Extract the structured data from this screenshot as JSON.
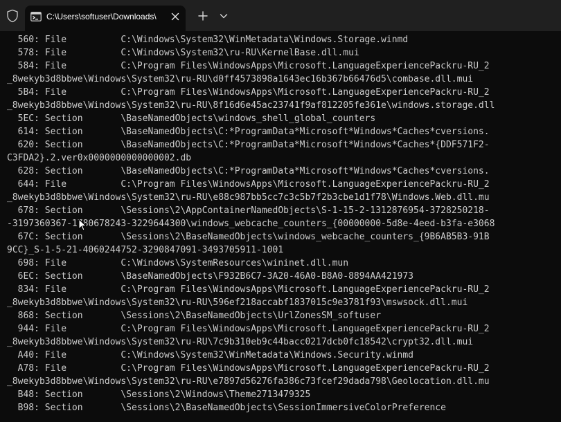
{
  "window": {
    "tab_title": "C:\\Users\\softuser\\Downloads\\",
    "icons": {
      "shield": "shield-icon",
      "tab": "terminal-icon",
      "close": "close-icon",
      "new_tab": "plus-icon",
      "dropdown": "chevron-down-icon"
    },
    "colors": {
      "tabbar": "#202020",
      "background": "#0c0c0c",
      "text": "#cccccc"
    }
  },
  "console": {
    "lines": [
      "  560: File          C:\\Windows\\System32\\WinMetadata\\Windows.Storage.winmd",
      "  578: File          C:\\Windows\\System32\\ru-RU\\KernelBase.dll.mui",
      "  584: File          C:\\Program Files\\WindowsApps\\Microsoft.LanguageExperiencePackru-RU_2",
      "_8wekyb3d8bbwe\\Windows\\System32\\ru-RU\\d0ff4573898a1643ec16b367b66476d5\\combase.dll.mui",
      "  5B4: File          C:\\Program Files\\WindowsApps\\Microsoft.LanguageExperiencePackru-RU_2",
      "_8wekyb3d8bbwe\\Windows\\System32\\ru-RU\\8f16d6e45ac23741f9af812205fe361e\\windows.storage.dll",
      "  5EC: Section       \\BaseNamedObjects\\windows_shell_global_counters",
      "  614: Section       \\BaseNamedObjects\\C:*ProgramData*Microsoft*Windows*Caches*cversions.",
      "  620: Section       \\BaseNamedObjects\\C:*ProgramData*Microsoft*Windows*Caches*{DDF571F2-",
      "C3FDA2}.2.ver0x0000000000000002.db",
      "  628: Section       \\BaseNamedObjects\\C:*ProgramData*Microsoft*Windows*Caches*cversions.",
      "  644: File          C:\\Program Files\\WindowsApps\\Microsoft.LanguageExperiencePackru-RU_2",
      "_8wekyb3d8bbwe\\Windows\\System32\\ru-RU\\e88c987bb5cc7c3c5b7f2b3cbe1d1f78\\Windows.Web.dll.mu",
      "  678: Section       \\Sessions\\2\\AppContainerNamedObjects\\S-1-15-2-1312876954-3728250218-",
      "-3197360367-1780678243-3229644300\\windows_webcache_counters_{00000000-5d8e-4eed-b3fa-e3068",
      "  67C: Section       \\Sessions\\2\\BaseNamedObjects\\windows_webcache_counters_{9B6AB5B3-91B",
      "9CC}_S-1-5-21-4060244752-3290847091-3493705911-1001",
      "  698: File          C:\\Windows\\SystemResources\\wininet.dll.mun",
      "  6EC: Section       \\BaseNamedObjects\\F932B6C7-3A20-46A0-B8A0-8894AA421973",
      "  834: File          C:\\Program Files\\WindowsApps\\Microsoft.LanguageExperiencePackru-RU_2",
      "_8wekyb3d8bbwe\\Windows\\System32\\ru-RU\\596ef218accabf1837015c9e3781f93\\mswsock.dll.mui",
      "  868: Section       \\Sessions\\2\\BaseNamedObjects\\UrlZonesSM_softuser",
      "  944: File          C:\\Program Files\\WindowsApps\\Microsoft.LanguageExperiencePackru-RU_2",
      "_8wekyb3d8bbwe\\Windows\\System32\\ru-RU\\7c9b310eb9c44bacc0217dcb0fc18542\\crypt32.dll.mui",
      "  A40: File          C:\\Windows\\System32\\WinMetadata\\Windows.Security.winmd",
      "  A78: File          C:\\Program Files\\WindowsApps\\Microsoft.LanguageExperiencePackru-RU_2",
      "_8wekyb3d8bbwe\\Windows\\System32\\ru-RU\\e7897d56276fa386c73fcef29dada798\\Geolocation.dll.mu",
      "  B48: Section       \\Sessions\\2\\Windows\\Theme2713479325",
      "  B98: Section       \\Sessions\\2\\BaseNamedObjects\\SessionImmersiveColorPreference"
    ]
  }
}
